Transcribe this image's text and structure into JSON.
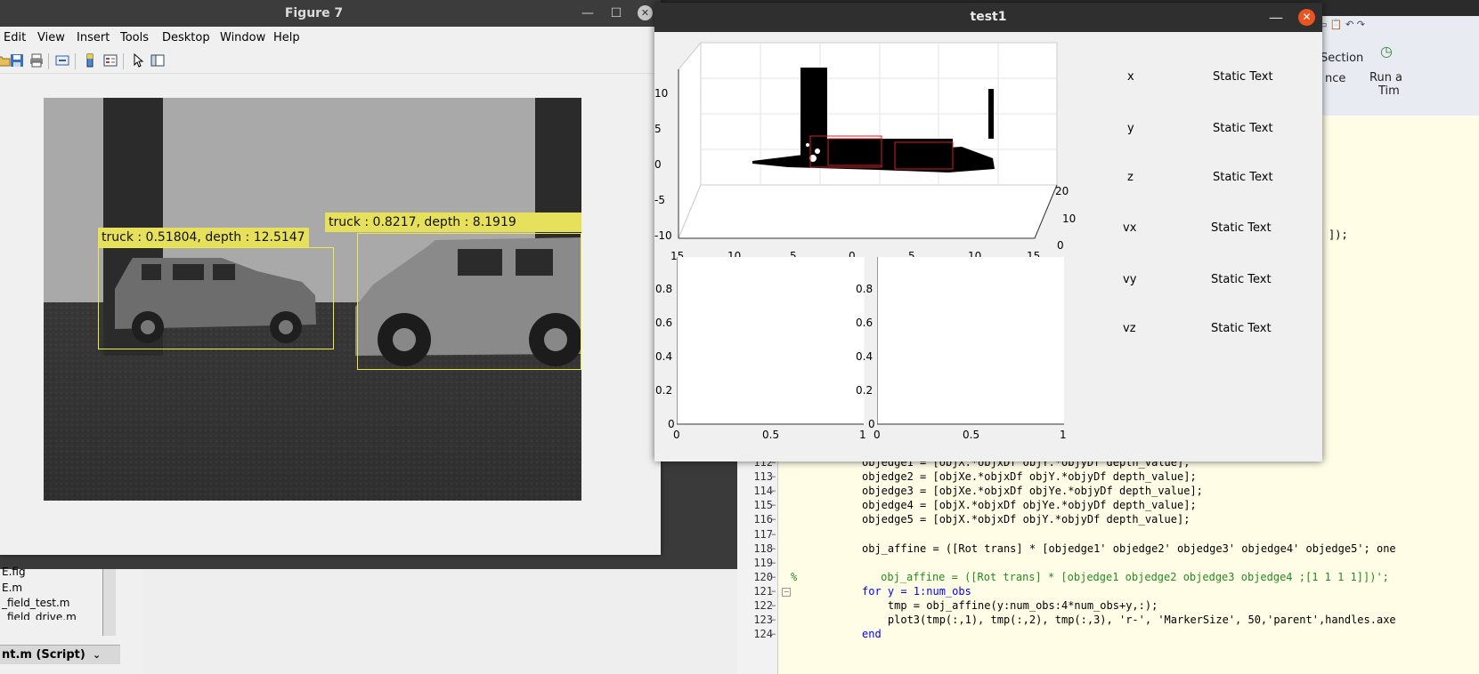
{
  "background": {
    "toolstrip": {
      "section_label": "Section",
      "advance_fragment": "nce",
      "run_time_label_1": "Run a",
      "run_time_label_2": "Tim"
    },
    "file_browser": {
      "files": [
        "E.fig",
        "E.m",
        "_field_test.m",
        "_field_drive.m"
      ],
      "current_file_label": "nt.m  (Script)"
    },
    "editor": {
      "fragment_line": "]);",
      "lines": [
        {
          "num": "112",
          "text": "objedge1 = [objX.*objxDf objY.*objyDf depth_value];"
        },
        {
          "num": "113",
          "text": "objedge2 = [objXe.*objxDf objY.*objyDf depth_value];"
        },
        {
          "num": "114",
          "text": "objedge3 = [objXe.*objxDf objYe.*objyDf depth_value];"
        },
        {
          "num": "115",
          "text": "objedge4 = [objX.*objxDf objYe.*objyDf depth_value];"
        },
        {
          "num": "116",
          "text": "objedge5 = [objX.*objxDf objY.*objyDf depth_value];"
        },
        {
          "num": "117",
          "text": ""
        },
        {
          "num": "118",
          "text": "obj_affine = ([Rot trans] * [objedge1' objedge2' objedge3' objedge4' objedge5'; one"
        },
        {
          "num": "119",
          "text": ""
        },
        {
          "num": "120",
          "text": "%             obj_affine = ([Rot trans] * [objedge1 objedge2 objedge3 objedge4 ;[1 1 1 1]])';"
        },
        {
          "num": "121",
          "text": "for y = 1:num_obs"
        },
        {
          "num": "122",
          "text": "    tmp = obj_affine(y:num_obs:4*num_obs+y,:);"
        },
        {
          "num": "123",
          "text": "    plot3(tmp(:,1), tmp(:,2), tmp(:,3), 'r-', 'MarkerSize', 50,'parent',handles.axe"
        },
        {
          "num": "124",
          "text": "end"
        }
      ]
    }
  },
  "figure7": {
    "title": "Figure 7",
    "menus": [
      "Edit",
      "View",
      "Insert",
      "Tools",
      "Desktop",
      "Window",
      "Help"
    ],
    "toolbar_icons": [
      "open-icon",
      "save-icon",
      "print-icon",
      "link-icon",
      "colorbar-icon",
      "legend-icon",
      "pointer-icon",
      "property-editor-icon"
    ],
    "detections": [
      {
        "label": "truck : 0.51804, depth : 12.5147"
      },
      {
        "label": "truck :  0.8217, depth :  8.1919"
      }
    ],
    "colors": {
      "box": "#f0e84a",
      "label_bg": "#e6e05a"
    }
  },
  "test1": {
    "title": "test1",
    "fields": [
      {
        "name": "x",
        "value": "Static Text"
      },
      {
        "name": "y",
        "value": "Static Text"
      },
      {
        "name": "z",
        "value": "Static Text"
      },
      {
        "name": "vx",
        "value": "Static Text"
      },
      {
        "name": "vy",
        "value": "Static Text"
      },
      {
        "name": "vz",
        "value": "Static Text"
      }
    ],
    "plot3d": {
      "z_ticks": [
        "10",
        "5",
        "0",
        "-5",
        "-10"
      ],
      "y_ticks": [
        "20",
        "10",
        "0"
      ],
      "x_ticks": [
        "15",
        "10",
        "5",
        "0",
        "5",
        "10",
        "15"
      ]
    },
    "plot_left": {
      "y_ticks": [
        "0",
        "0.2",
        "0.4",
        "0.6",
        "0.8"
      ],
      "x_ticks": [
        "0",
        "0.5",
        "1"
      ]
    },
    "plot_right": {
      "y_ticks": [
        "0",
        "0.2",
        "0.4",
        "0.6",
        "0.8"
      ],
      "x_ticks": [
        "0",
        "0.5",
        "1"
      ]
    },
    "colors": {
      "close": "#e95420",
      "bbox3d": "#d62020"
    }
  }
}
